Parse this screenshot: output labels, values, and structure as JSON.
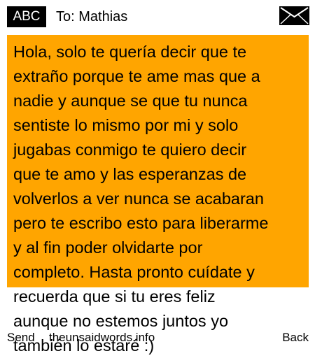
{
  "header": {
    "input_mode": "ABC",
    "recipient": "To: Mathias",
    "envelope_icon": "envelope-icon"
  },
  "message": {
    "body": "Hola, solo te quería decir que te\nextraño porque te ame mas que a\nnadie y aunque se que tu nunca\nsentiste lo mismo por mi y solo\njugabas conmigo te quiero decir\nque te amo y las esperanzas de\nvolverlos a ver nunca se acabaran\npero te escribo esto para liberarme\ny al fin poder olvidarte por\ncompleto. Hasta pronto cuídate y\nrecuerda que si tu eres feliz\naunque no estemos juntos yo\ntambién lo estaré :)",
    "highlight_color": "#ffa500"
  },
  "footer": {
    "send_label": "Send",
    "site_label": "theunsaidwords.info",
    "back_label": "Back"
  }
}
